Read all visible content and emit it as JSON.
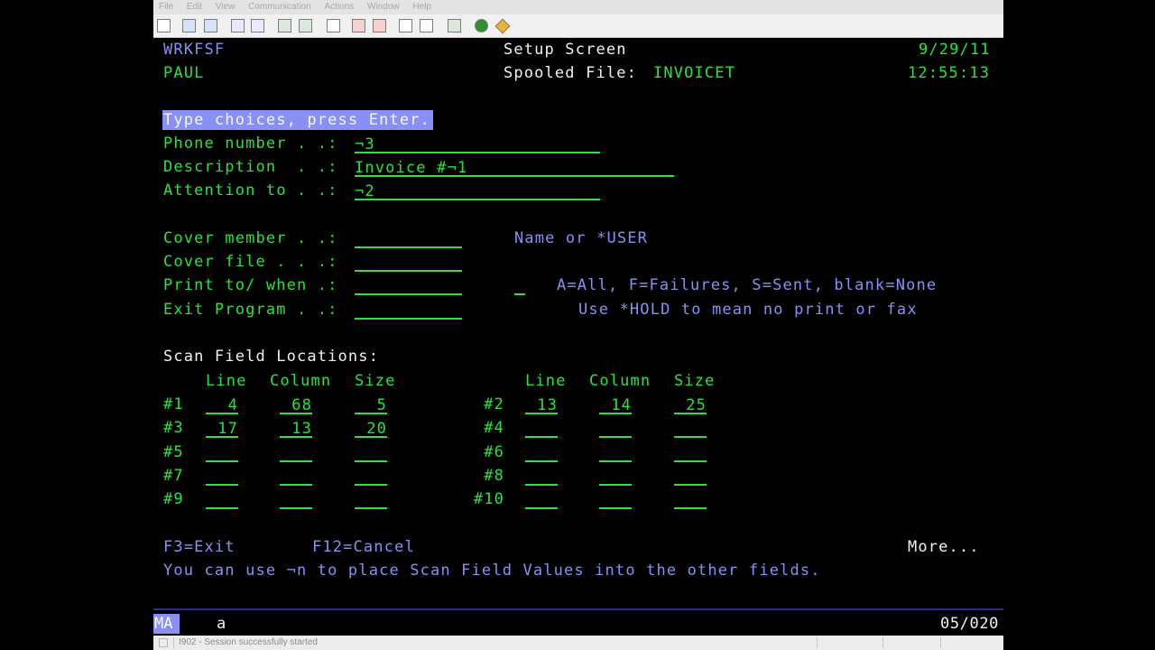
{
  "menu": [
    "File",
    "Edit",
    "View",
    "Communication",
    "Actions",
    "Window",
    "Help"
  ],
  "toolbar_icons": [
    "print-icon",
    "copy-icon",
    "paste-icon",
    "send-icon",
    "receive-icon",
    "display-icon",
    "keyboard-icon",
    "chart-icon",
    "record-icon",
    "macro-icon",
    "play-icon",
    "stop-icon",
    "clipboard-icon",
    "globe-icon",
    "edit-icon"
  ],
  "header": {
    "program": "WRKFSF",
    "user": "PAUL",
    "title": "Setup Screen",
    "spooled_label": "Spooled File:",
    "spooled_value": "INVOICET",
    "date": "9/29/11",
    "time": "12:55:13"
  },
  "instruction": "Type choices, press Enter.",
  "fields": [
    {
      "label": "Phone number . .:",
      "value": "¬3"
    },
    {
      "label": "Description  . .:",
      "value": "Invoice #¬1"
    },
    {
      "label": "Attention to . .:",
      "value": "¬2"
    }
  ],
  "cover_fields": [
    {
      "label": "Cover member . .:",
      "value": ""
    },
    {
      "label": "Cover file . . .:",
      "value": ""
    },
    {
      "label": "Print to/ when .:",
      "value": ""
    },
    {
      "label": "Exit Program . .:",
      "value": ""
    }
  ],
  "hints": {
    "cover_member": "Name or *USER",
    "print_when": "A=All, F=Failures, S=Sent, blank=None",
    "print_to": "Use *HOLD to mean no print or fax"
  },
  "scan": {
    "title": "Scan Field Locations:",
    "col_line": "Line",
    "col_column": "Column",
    "col_size": "Size",
    "left": [
      {
        "id": "#1",
        "line": "4",
        "column": "68",
        "size": "5"
      },
      {
        "id": "#3",
        "line": "17",
        "column": "13",
        "size": "20"
      },
      {
        "id": "#5",
        "line": "",
        "column": "",
        "size": ""
      },
      {
        "id": "#7",
        "line": "",
        "column": "",
        "size": ""
      },
      {
        "id": "#9",
        "line": "",
        "column": "",
        "size": ""
      }
    ],
    "right": [
      {
        "id": "#2",
        "line": "13",
        "column": "14",
        "size": "25"
      },
      {
        "id": "#4",
        "line": "",
        "column": "",
        "size": ""
      },
      {
        "id": "#6",
        "line": "",
        "column": "",
        "size": ""
      },
      {
        "id": "#8",
        "line": "",
        "column": "",
        "size": ""
      },
      {
        "id": "#10",
        "line": "",
        "column": "",
        "size": ""
      }
    ]
  },
  "footer": {
    "f3": "F3=Exit",
    "f12": "F12=Cancel",
    "more": "More...",
    "message": "You can use ¬n to place Scan Field Values into the other fields."
  },
  "oia": {
    "mode": "MA",
    "indicator": "a",
    "position": "05/020"
  },
  "statusbar": {
    "message": "I902 - Session successfully started"
  },
  "colors": {
    "green": "#29e33c",
    "blue": "#8890f5",
    "white": "#f1f1f1"
  }
}
